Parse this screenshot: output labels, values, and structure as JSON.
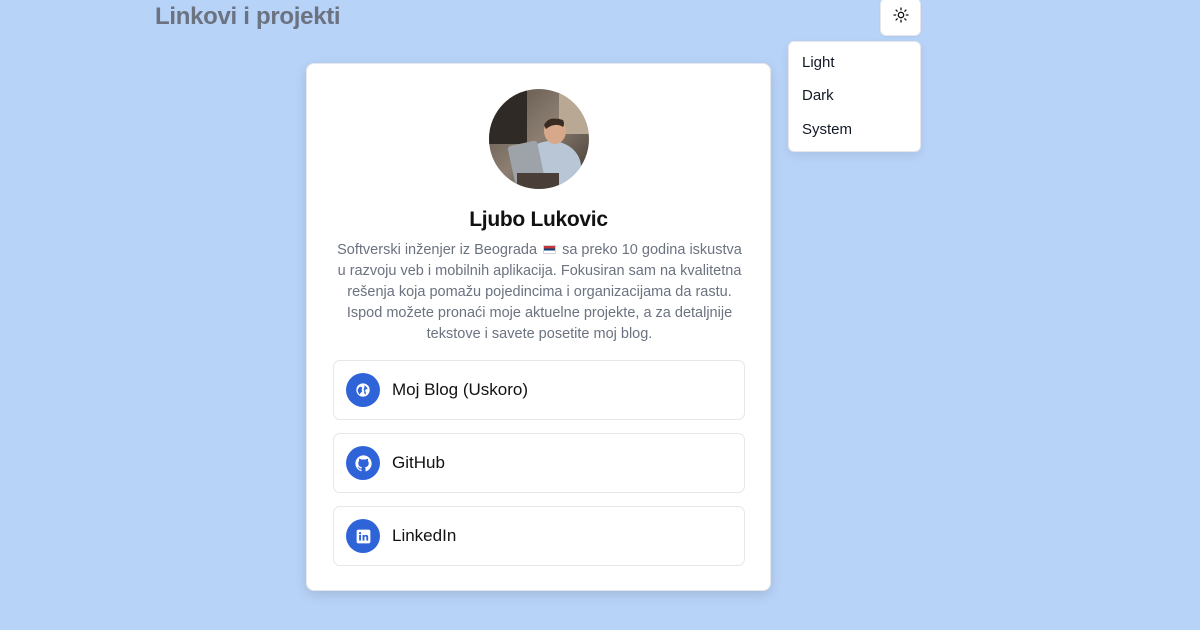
{
  "header": {
    "title": "Linkovi i projekti",
    "theme_toggle_icon": "sun-icon"
  },
  "theme_menu": {
    "options": [
      "Light",
      "Dark",
      "System"
    ]
  },
  "profile": {
    "name": "Ljubo Lukovic",
    "bio_part1": "Softverski inženjer iz Beograda",
    "bio_part2": "sa preko 10 godina iskustva u razvoju veb i mobilnih aplikacija. Fokusiran sam na kvalitetna rešenja koja pomažu pojedincima i organizacijama da rastu. Ispod možete pronaći moje aktuelne projekte, a za detaljnije tekstove i savete posetite moj blog.",
    "flag_icon": "serbia-flag-icon"
  },
  "links": [
    {
      "label": "Moj Blog (Uskoro)",
      "icon": "globe-icon"
    },
    {
      "label": "GitHub",
      "icon": "github-icon"
    },
    {
      "label": "LinkedIn",
      "icon": "linkedin-icon"
    }
  ],
  "colors": {
    "background": "#b8d3f8",
    "accent": "#2f63d8",
    "title_gray": "#6b7280"
  }
}
